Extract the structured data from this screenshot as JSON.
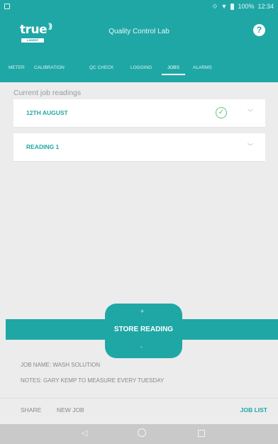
{
  "status_bar": {
    "time": "12:34",
    "battery": "100%",
    "icons": [
      "vibrate-icon",
      "wifi-icon",
      "signal-icon",
      "battery-icon"
    ]
  },
  "app_bar": {
    "logo_text": "true",
    "logo_badge": "LABREP",
    "title": "Quality Control Lab",
    "help_icon": "?"
  },
  "tabs": [
    {
      "label": "METER",
      "active": false
    },
    {
      "label": "CALIBRATION",
      "active": false
    },
    {
      "label": "QC CHECK",
      "active": false
    },
    {
      "label": "LOGGING",
      "active": false
    },
    {
      "label": "JOBS",
      "active": true
    },
    {
      "label": "ALARMS",
      "active": false
    }
  ],
  "content": {
    "section_title": "Current job readings",
    "readings": [
      {
        "label": "12TH AUGUST",
        "checked": true,
        "expand_icon": "chevron-down-icon"
      },
      {
        "label": "READING 1",
        "checked": false,
        "expand_icon": "chevron-down-icon"
      }
    ]
  },
  "store": {
    "plus": "+",
    "label": "STORE READING",
    "minus": "-"
  },
  "job_info": {
    "name": "JOB NAME: WASH SOLUTION",
    "notes": "NOTES: GARY KEMP TO MEASURE EVERY TUESDAY"
  },
  "actions": {
    "share": "SHARE",
    "new_job": "NEW JOB",
    "job_list": "JOB LIST"
  },
  "colors": {
    "primary": "#1fa7a6",
    "check": "#65c27a"
  }
}
